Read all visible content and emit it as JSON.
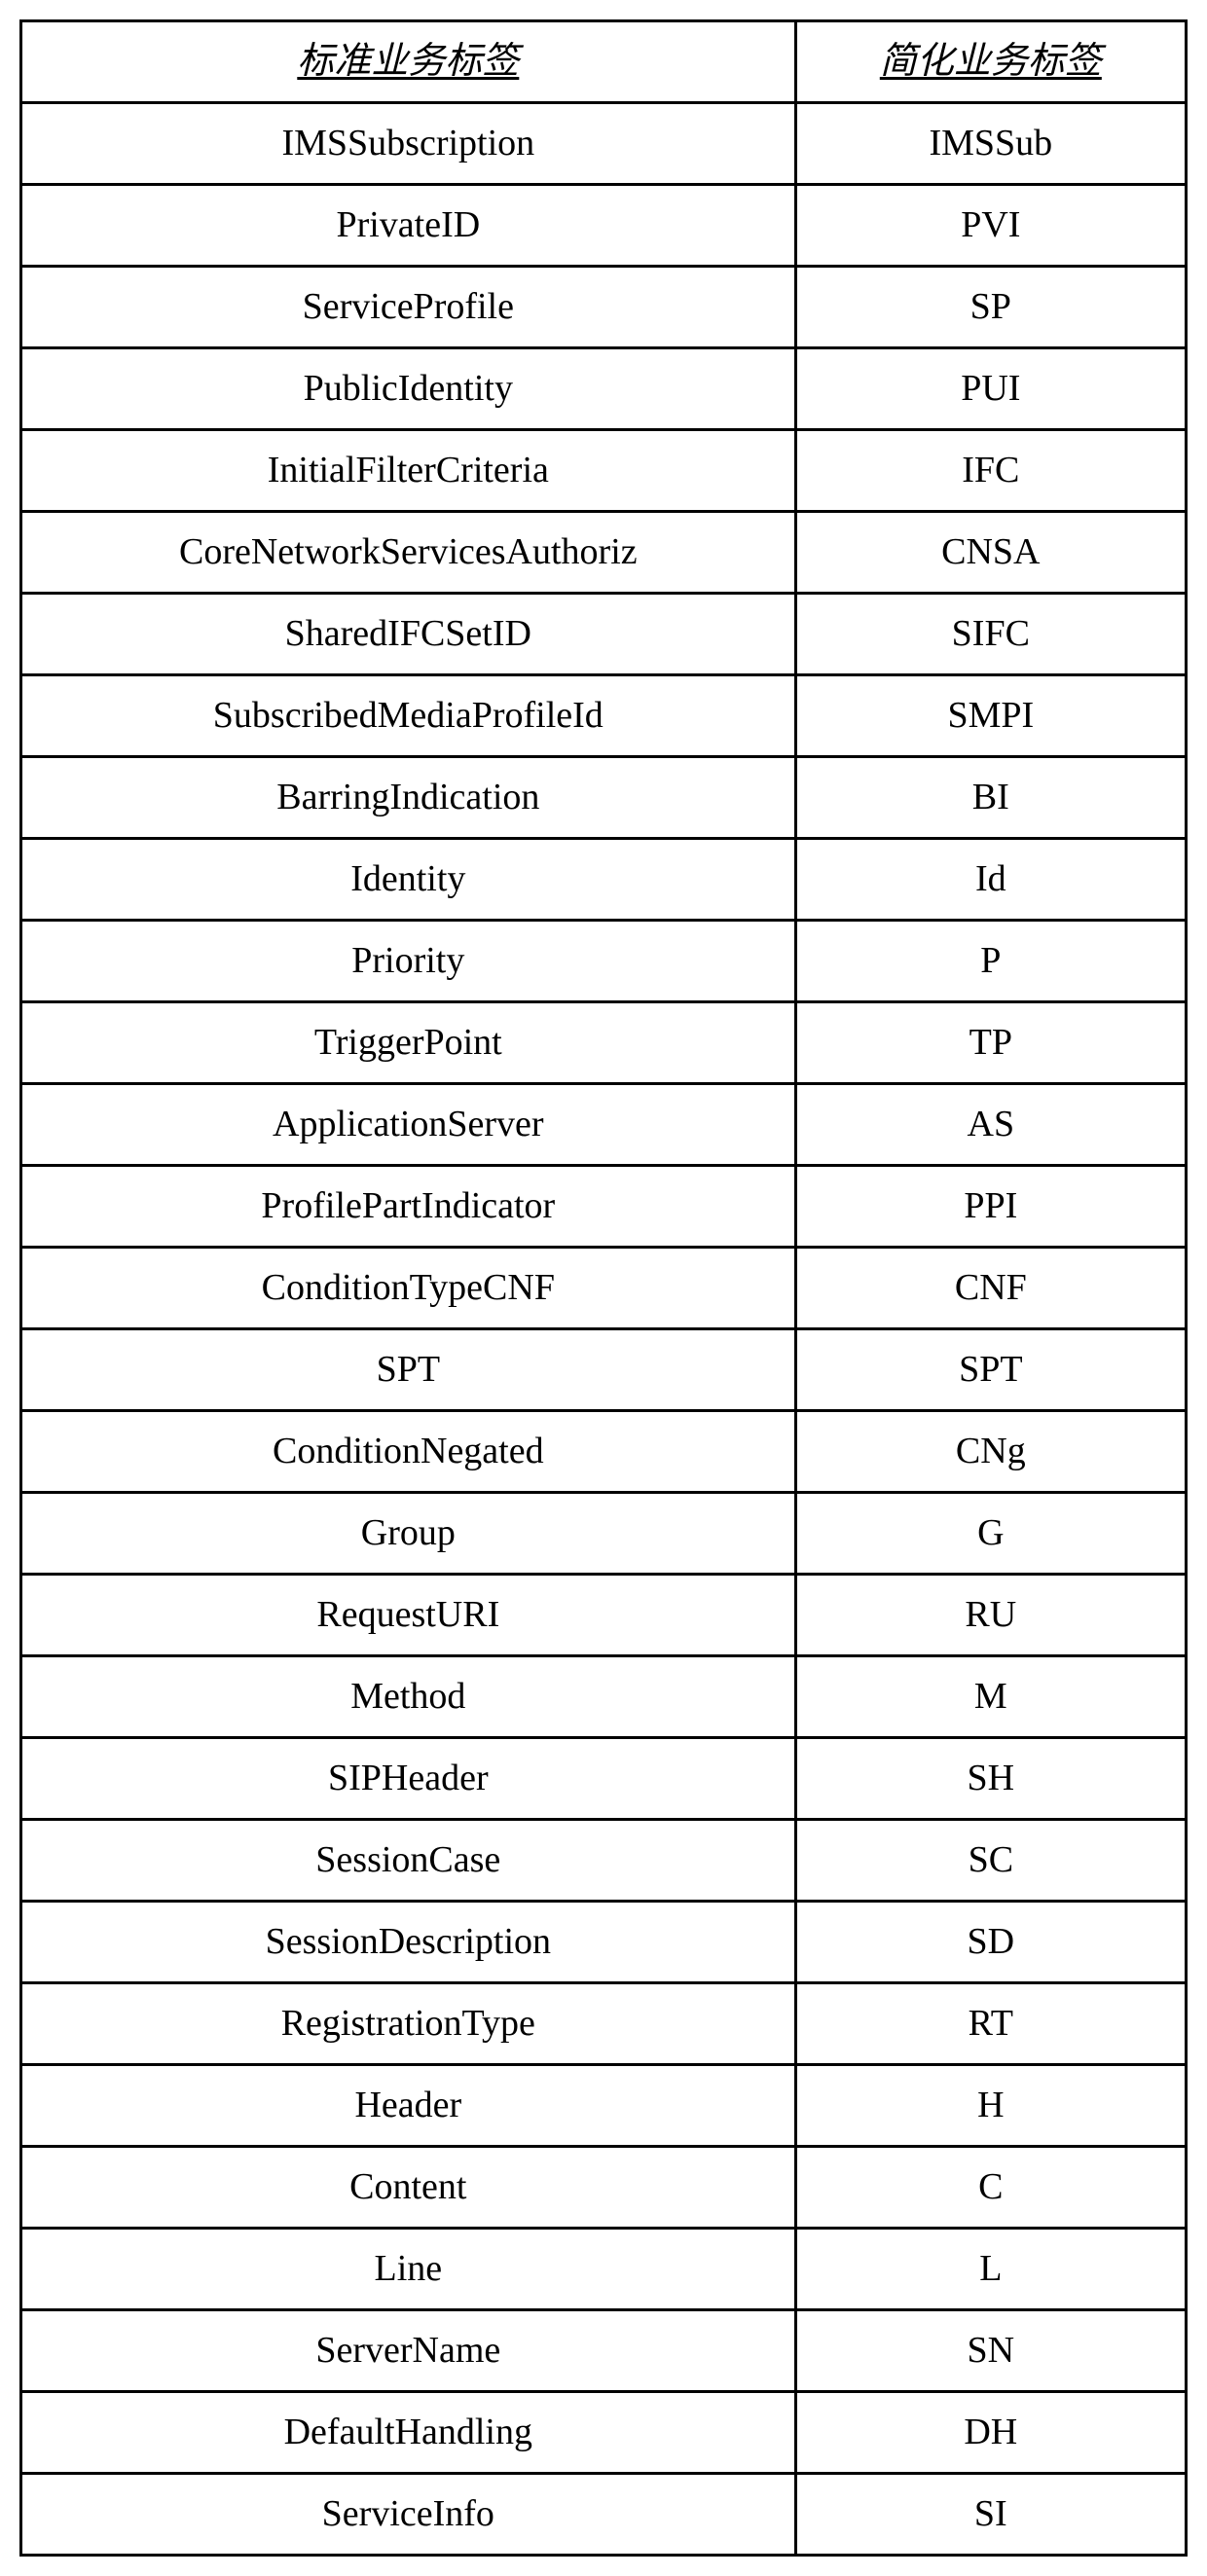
{
  "table": {
    "headers": {
      "col1": "标准业务标签",
      "col2": "简化业务标签"
    },
    "rows": [
      {
        "c1": "IMSSubscription",
        "c2": "IMSSub"
      },
      {
        "c1": "PrivateID",
        "c2": "PVI"
      },
      {
        "c1": "ServiceProfile",
        "c2": "SP"
      },
      {
        "c1": "PublicIdentity",
        "c2": "PUI"
      },
      {
        "c1": "InitialFilterCriteria",
        "c2": "IFC"
      },
      {
        "c1": "CoreNetworkServicesAuthoriz",
        "c2": "CNSA"
      },
      {
        "c1": "SharedIFCSetID",
        "c2": "SIFC"
      },
      {
        "c1": "SubscribedMediaProfileId",
        "c2": "SMPI"
      },
      {
        "c1": "BarringIndication",
        "c2": "BI"
      },
      {
        "c1": "Identity",
        "c2": "Id"
      },
      {
        "c1": "Priority",
        "c2": "P"
      },
      {
        "c1": "TriggerPoint",
        "c2": "TP"
      },
      {
        "c1": "ApplicationServer",
        "c2": "AS"
      },
      {
        "c1": "ProfilePartIndicator",
        "c2": "PPI"
      },
      {
        "c1": "ConditionTypeCNF",
        "c2": "CNF"
      },
      {
        "c1": "SPT",
        "c2": "SPT"
      },
      {
        "c1": "ConditionNegated",
        "c2": "CNg"
      },
      {
        "c1": "Group",
        "c2": "G"
      },
      {
        "c1": "RequestURI",
        "c2": "RU"
      },
      {
        "c1": "Method",
        "c2": "M"
      },
      {
        "c1": "SIPHeader",
        "c2": "SH"
      },
      {
        "c1": "SessionCase",
        "c2": "SC"
      },
      {
        "c1": "SessionDescription",
        "c2": "SD"
      },
      {
        "c1": "RegistrationType",
        "c2": "RT"
      },
      {
        "c1": "Header",
        "c2": "H"
      },
      {
        "c1": "Content",
        "c2": "C"
      },
      {
        "c1": "Line",
        "c2": "L"
      },
      {
        "c1": "ServerName",
        "c2": "SN"
      },
      {
        "c1": "DefaultHandling",
        "c2": "DH"
      },
      {
        "c1": "ServiceInfo",
        "c2": "SI"
      }
    ]
  }
}
